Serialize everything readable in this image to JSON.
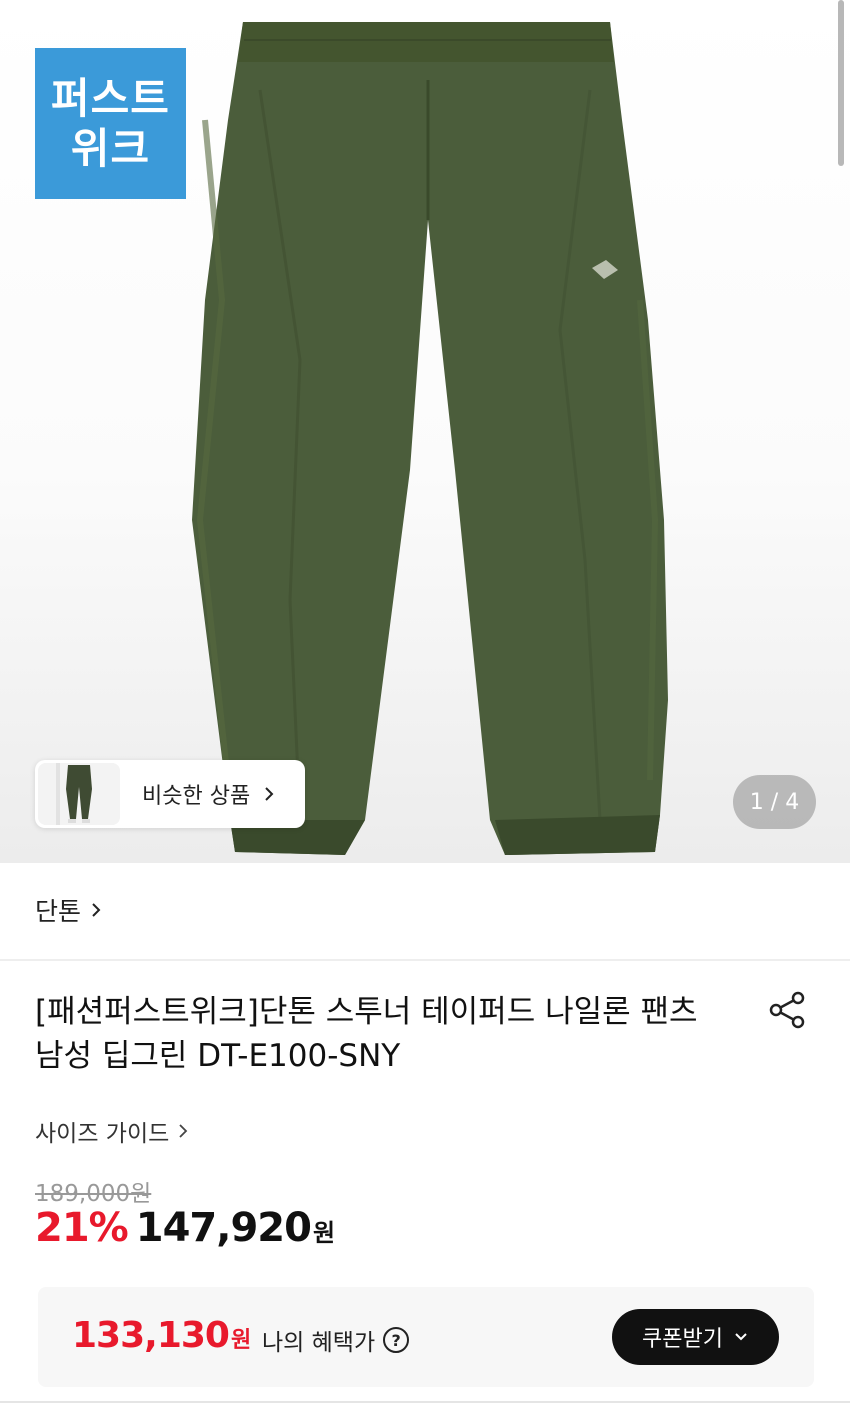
{
  "gallery": {
    "badge_line1": "퍼스트",
    "badge_line2": "위크",
    "similar_label": "비슷한 상품",
    "counter": "1 / 4"
  },
  "brand": {
    "name": "단톤"
  },
  "product": {
    "title": "[패션퍼스트위크]단톤 스투너 테이퍼드 나일론 팬츠 남성 딥그린 DT-E100-SNY",
    "size_guide": "사이즈 가이드",
    "original_price": "189,000원",
    "discount": "21%",
    "price": "147,920",
    "price_unit": "원"
  },
  "benefit": {
    "price": "133,130",
    "price_unit": "원",
    "label": "나의 혜택가",
    "help_glyph": "?",
    "coupon_button": "쿠폰받기"
  },
  "colors": {
    "accent_red": "#e8192c",
    "badge_blue": "#3b9ad9",
    "product_green": "#4a5c3a"
  },
  "icons": [
    "chevron-right-icon",
    "share-icon",
    "help-icon",
    "chevron-down-icon"
  ]
}
